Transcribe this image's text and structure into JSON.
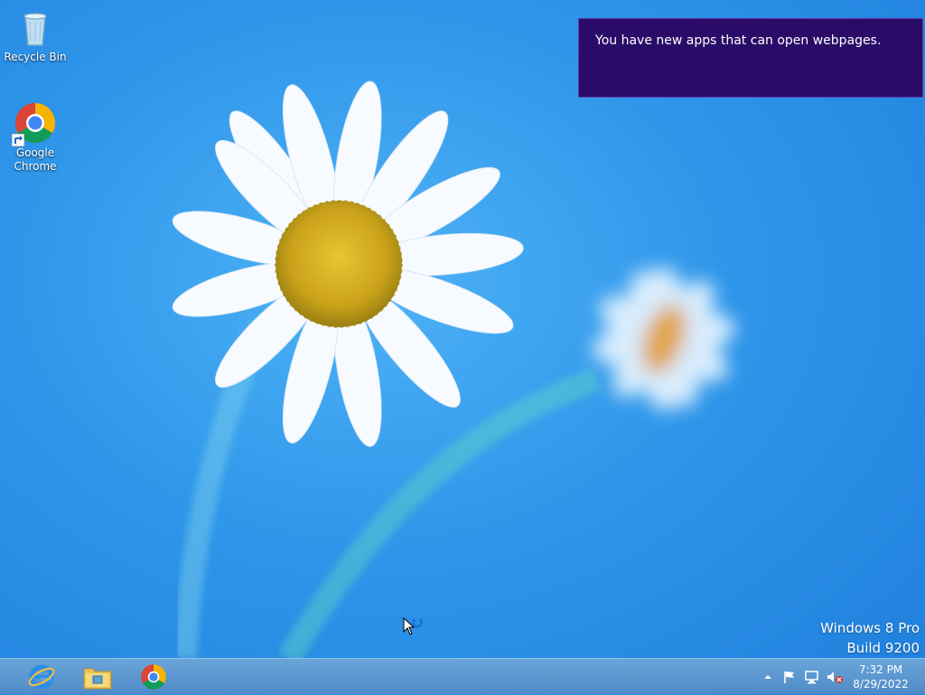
{
  "desktop": {
    "icons": [
      {
        "label": "Recycle Bin"
      },
      {
        "label": "Google\nChrome"
      }
    ]
  },
  "notification": {
    "message": "You have new apps that can open webpages."
  },
  "watermark": {
    "line1": "Windows 8 Pro",
    "line2": "Build 9200"
  },
  "taskbar": {
    "pinned": [
      {
        "icon": "internet-explorer-icon"
      },
      {
        "icon": "file-explorer-icon"
      },
      {
        "icon": "chrome-icon"
      }
    ],
    "tray": {
      "icons": [
        "show-hidden-icons-chevron-icon",
        "action-center-flag-icon",
        "network-icon",
        "volume-muted-icon"
      ],
      "time": "7:32 PM",
      "date": "8/29/2022"
    }
  },
  "colors": {
    "notification_bg": "#2a0c68",
    "taskbar": "#5a95cf",
    "desktop": "#2f96ea"
  }
}
